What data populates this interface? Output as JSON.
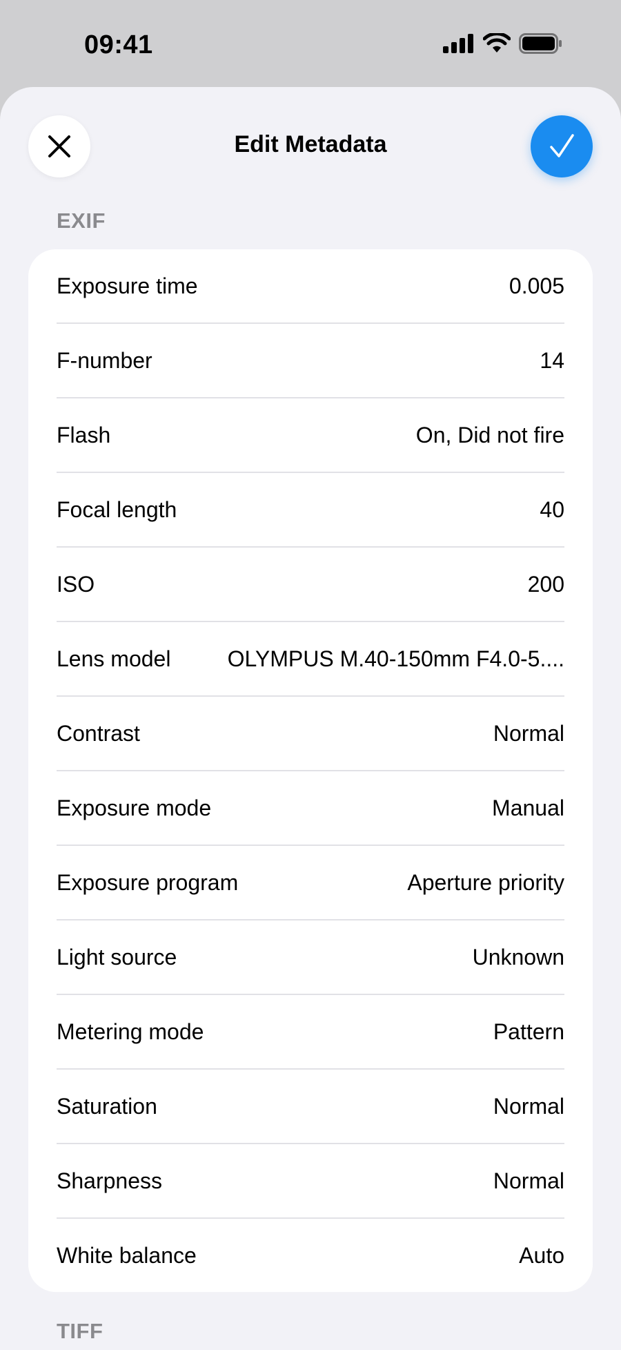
{
  "status_bar": {
    "time": "09:41"
  },
  "header": {
    "title": "Edit Metadata",
    "close_icon": "close-icon",
    "confirm_icon": "checkmark-icon",
    "accent_color": "#1a8cf0"
  },
  "sections": [
    {
      "title": "EXIF",
      "rows": [
        {
          "label": "Exposure time",
          "value": "0.005"
        },
        {
          "label": "F-number",
          "value": "14"
        },
        {
          "label": "Flash",
          "value": "On, Did not fire"
        },
        {
          "label": "Focal length",
          "value": "40"
        },
        {
          "label": "ISO",
          "value": "200"
        },
        {
          "label": "Lens model",
          "value": "OLYMPUS M.40-150mm F4.0-5...."
        },
        {
          "label": "Contrast",
          "value": "Normal"
        },
        {
          "label": "Exposure mode",
          "value": "Manual"
        },
        {
          "label": "Exposure program",
          "value": "Aperture priority"
        },
        {
          "label": "Light source",
          "value": "Unknown"
        },
        {
          "label": "Metering mode",
          "value": "Pattern"
        },
        {
          "label": "Saturation",
          "value": "Normal"
        },
        {
          "label": "Sharpness",
          "value": "Normal"
        },
        {
          "label": "White balance",
          "value": "Auto"
        }
      ]
    },
    {
      "title": "TIFF",
      "rows": []
    }
  ]
}
